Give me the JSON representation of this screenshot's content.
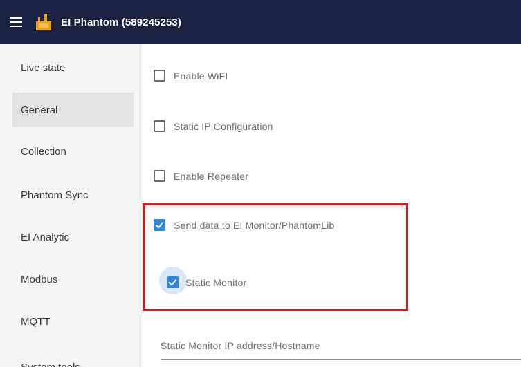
{
  "header": {
    "title": "EI Phantom (589245253)",
    "menu_icon": "hamburger-menu-icon",
    "logo_icon": "ei-phantom-logo",
    "background": "#1b2140"
  },
  "sidebar": {
    "active_index": 1,
    "items": [
      {
        "label": "Live state"
      },
      {
        "label": "General"
      },
      {
        "label": "Collection"
      },
      {
        "label": "Phantom Sync"
      },
      {
        "label": "EI Analytic"
      },
      {
        "label": "Modbus"
      },
      {
        "label": "MQTT"
      },
      {
        "label": "System tools"
      }
    ]
  },
  "settings": [
    {
      "label": "Enable WiFI",
      "checked": false
    },
    {
      "label": "Static IP Configuration",
      "checked": false
    },
    {
      "label": "Enable Repeater",
      "checked": false
    },
    {
      "label": "Send data to EI Monitor/PhantomLib",
      "checked": true
    },
    {
      "label": "Static Monitor",
      "checked": true
    }
  ],
  "monitor_address": {
    "label": "Static Monitor IP address/Hostname",
    "value": ""
  },
  "colors": {
    "accent": "#2e86de",
    "highlight": "#e0161d"
  }
}
